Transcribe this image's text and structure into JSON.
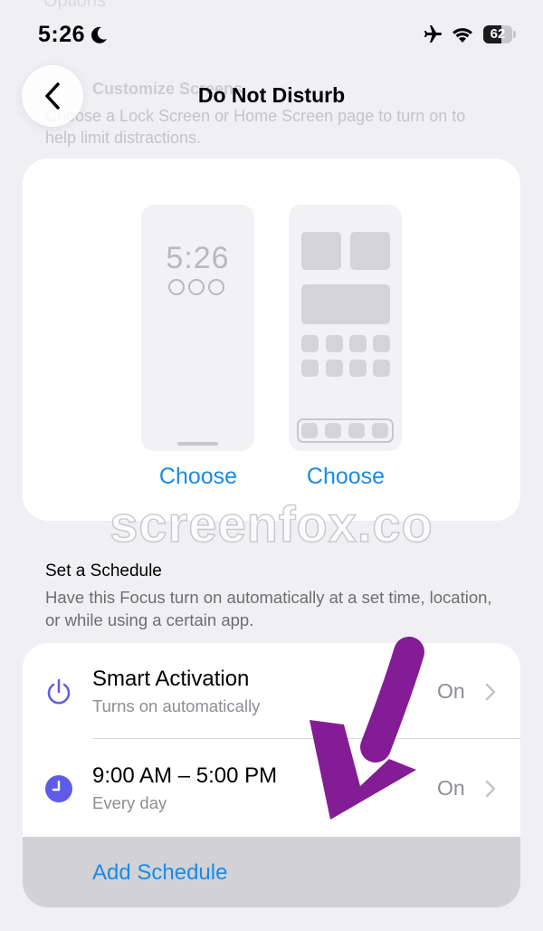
{
  "status_bar": {
    "time": "5:26",
    "battery_level": "62",
    "battery_fraction": 0.62
  },
  "background_text": {
    "top": "Options",
    "title": "Customize Screens",
    "description": "Choose a Lock Screen or Home Screen page to turn on to help limit distractions."
  },
  "nav": {
    "title": "Do Not Disturb"
  },
  "preview": {
    "lock_screen_time": "5:26",
    "lock_choose_label": "Choose",
    "home_choose_label": "Choose"
  },
  "watermark": "screenfox.co",
  "schedule": {
    "title": "Set a Schedule",
    "description": "Have this Focus turn on automatically at a set time, location, or while using a certain app.",
    "items": [
      {
        "title": "Smart Activation",
        "subtitle": "Turns on automatically",
        "value": "On",
        "icon": "power-icon"
      },
      {
        "title": "9:00 AM – 5:00 PM",
        "subtitle": "Every day",
        "value": "On",
        "icon": "clock-icon"
      }
    ],
    "add_label": "Add Schedule"
  },
  "colors": {
    "accent": "#1a8be6",
    "icon_purple": "#5e5ce6",
    "annotation": "#7a0a8c"
  }
}
